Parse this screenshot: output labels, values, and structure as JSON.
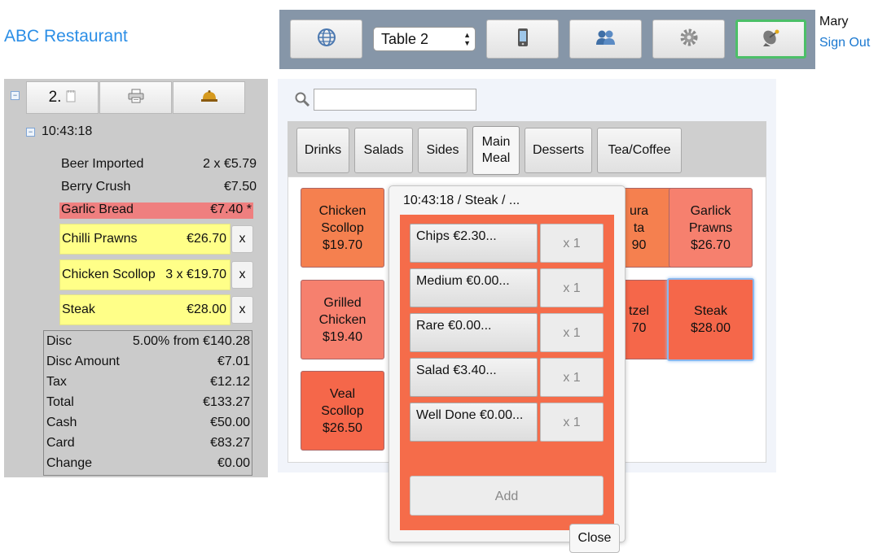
{
  "app": {
    "title": "ABC Restaurant"
  },
  "toolbar": {
    "table_value": "Table 2",
    "icons": [
      "globe-icon",
      "phone-icon",
      "users-icon",
      "gear-icon",
      "satellite-icon"
    ]
  },
  "user": {
    "name": "Mary",
    "sign_out": "Sign Out"
  },
  "order": {
    "number": "2.",
    "time": "10:43:18",
    "items": [
      {
        "name": "Beer Imported",
        "price": "2 x €5.79"
      },
      {
        "name": "Berry Crush",
        "price": "€7.50"
      },
      {
        "name": "Garlic Bread",
        "price": "€7.40 *"
      }
    ],
    "pending": [
      {
        "name": "Chilli Prawns",
        "price": "€26.70",
        "remove": "x"
      },
      {
        "name": "Chicken Scollop",
        "price": "3 x €19.70",
        "remove": "x"
      },
      {
        "name": "Steak",
        "price": "€28.00",
        "remove": "x"
      }
    ],
    "summary": [
      {
        "label": "Disc",
        "value": "5.00% from €140.28"
      },
      {
        "label": "Disc Amount",
        "value": "€7.01"
      },
      {
        "label": "Tax",
        "value": "€12.12"
      },
      {
        "label": "Total",
        "value": "€133.27"
      },
      {
        "label": "Cash",
        "value": "€50.00"
      },
      {
        "label": "Card",
        "value": "€83.27"
      },
      {
        "label": "Change",
        "value": "€0.00"
      }
    ]
  },
  "menu": {
    "tabs": [
      {
        "label": "Drinks"
      },
      {
        "label": "Salads"
      },
      {
        "label": "Sides"
      },
      {
        "label": "Main\nMeal"
      },
      {
        "label": "Desserts"
      },
      {
        "label": "Tea/Coffee"
      }
    ],
    "selected_tab": "Main Meal",
    "tiles": [
      {
        "label": "Chicken\nScollop\n$19.70",
        "color": "#f5804f"
      },
      {
        "label": "Grilled\nChicken\n$19.40",
        "color": "#f6806e"
      },
      {
        "label": "Veal\nScollop\n$26.50",
        "color": "#f5674a"
      },
      {
        "label": "ura\nta\n90",
        "color": "#f5804f"
      },
      {
        "label": "tzel\n70",
        "color": "#f5674a"
      },
      {
        "label": "Garlick\nPrawns\n$26.70",
        "color": "#f6806e"
      },
      {
        "label": "Steak\n$28.00",
        "color": "#f5674a"
      }
    ]
  },
  "popup": {
    "title": "10:43:18 / Steak / ...",
    "modifiers": [
      {
        "label": "Chips €2.30...",
        "qty": "x 1"
      },
      {
        "label": "Medium €0.00...",
        "qty": "x 1"
      },
      {
        "label": "Rare €0.00...",
        "qty": "x 1"
      },
      {
        "label": "Salad €3.40...",
        "qty": "x 1"
      },
      {
        "label": "Well Done €0.00...",
        "qty": "x 1"
      }
    ],
    "add": "Add",
    "close": "Close"
  }
}
